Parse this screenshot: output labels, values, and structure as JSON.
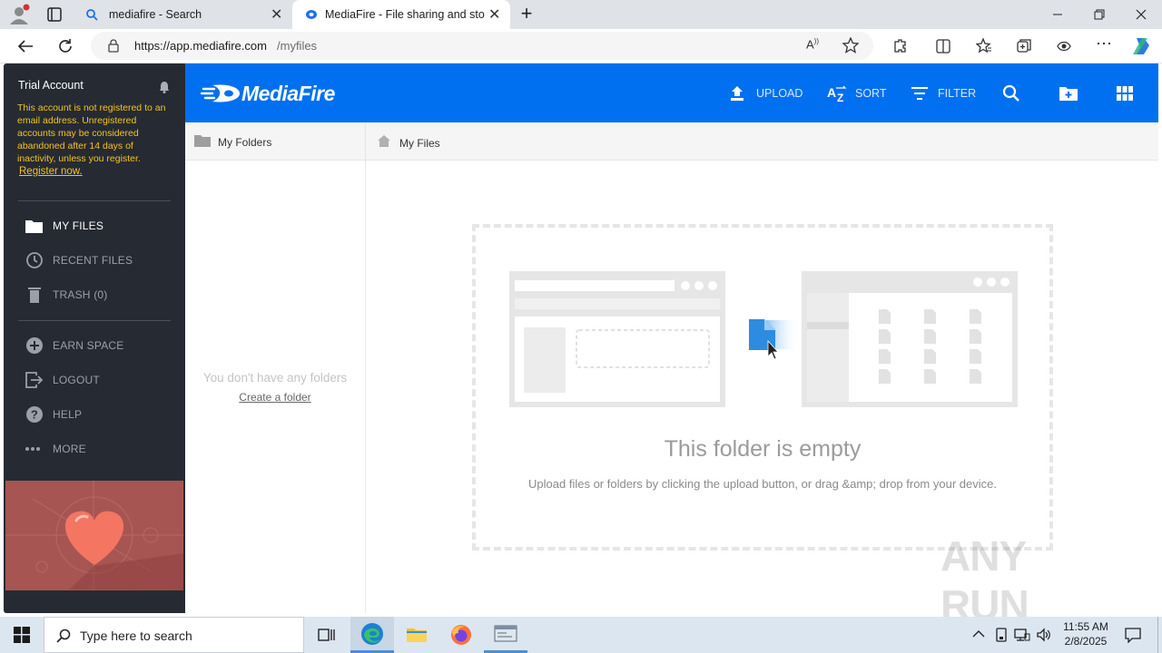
{
  "browser": {
    "tabs": [
      {
        "title": "mediafire - Search",
        "icon": "search-icon"
      },
      {
        "title": "MediaFire - File sharing and stora",
        "icon": "mediafire-icon"
      }
    ],
    "url_host": "https://app.mediafire.com",
    "url_path": "/myfiles"
  },
  "sidebar": {
    "account_title": "Trial Account",
    "notice": "This account is not registered to an email address. Unregistered accounts may be considered abandoned after 14 days of inactivity, unless you register.",
    "register_link": "Register now.",
    "items": [
      {
        "label": "MY FILES",
        "icon": "folder-icon"
      },
      {
        "label": "RECENT FILES",
        "icon": "clock-icon"
      },
      {
        "label": "TRASH (0)",
        "icon": "trash-icon"
      },
      {
        "label": "EARN SPACE",
        "icon": "plus-circle-icon"
      },
      {
        "label": "LOGOUT",
        "icon": "logout-icon"
      },
      {
        "label": "HELP",
        "icon": "help-icon"
      },
      {
        "label": "MORE",
        "icon": "more-icon"
      }
    ]
  },
  "header": {
    "logo": "MediaFire",
    "upload": "UPLOAD",
    "sort": "SORT",
    "filter": "FILTER"
  },
  "folders": {
    "title": "My Folders",
    "empty": "You don't have any folders",
    "create": "Create a folder"
  },
  "breadcrumb": {
    "home": "My Files"
  },
  "empty_state": {
    "title": "This folder is empty",
    "desc": "Upload files or folders by clicking the upload button, or drag &amp; drop from your device."
  },
  "watermark": "ANY RUN",
  "taskbar": {
    "search_placeholder": "Type here to search",
    "time": "11:55 AM",
    "date": "2/8/2025"
  },
  "colors": {
    "brand": "#0070f0",
    "sidebar": "#262a33",
    "notice": "#f5c518"
  }
}
